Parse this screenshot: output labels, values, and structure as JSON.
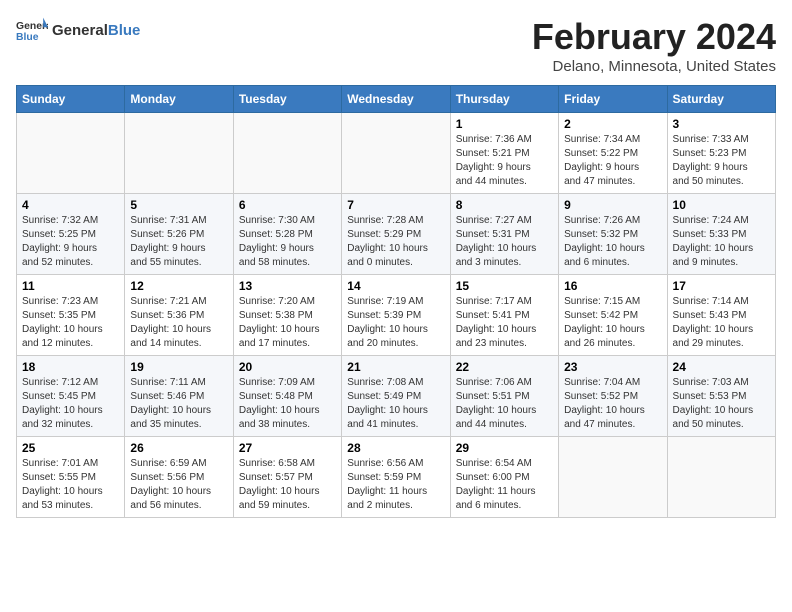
{
  "header": {
    "logo_general": "General",
    "logo_blue": "Blue",
    "month_year": "February 2024",
    "location": "Delano, Minnesota, United States"
  },
  "days_of_week": [
    "Sunday",
    "Monday",
    "Tuesday",
    "Wednesday",
    "Thursday",
    "Friday",
    "Saturday"
  ],
  "weeks": [
    [
      {
        "day": "",
        "info": ""
      },
      {
        "day": "",
        "info": ""
      },
      {
        "day": "",
        "info": ""
      },
      {
        "day": "",
        "info": ""
      },
      {
        "day": "1",
        "info": "Sunrise: 7:36 AM\nSunset: 5:21 PM\nDaylight: 9 hours\nand 44 minutes."
      },
      {
        "day": "2",
        "info": "Sunrise: 7:34 AM\nSunset: 5:22 PM\nDaylight: 9 hours\nand 47 minutes."
      },
      {
        "day": "3",
        "info": "Sunrise: 7:33 AM\nSunset: 5:23 PM\nDaylight: 9 hours\nand 50 minutes."
      }
    ],
    [
      {
        "day": "4",
        "info": "Sunrise: 7:32 AM\nSunset: 5:25 PM\nDaylight: 9 hours\nand 52 minutes."
      },
      {
        "day": "5",
        "info": "Sunrise: 7:31 AM\nSunset: 5:26 PM\nDaylight: 9 hours\nand 55 minutes."
      },
      {
        "day": "6",
        "info": "Sunrise: 7:30 AM\nSunset: 5:28 PM\nDaylight: 9 hours\nand 58 minutes."
      },
      {
        "day": "7",
        "info": "Sunrise: 7:28 AM\nSunset: 5:29 PM\nDaylight: 10 hours\nand 0 minutes."
      },
      {
        "day": "8",
        "info": "Sunrise: 7:27 AM\nSunset: 5:31 PM\nDaylight: 10 hours\nand 3 minutes."
      },
      {
        "day": "9",
        "info": "Sunrise: 7:26 AM\nSunset: 5:32 PM\nDaylight: 10 hours\nand 6 minutes."
      },
      {
        "day": "10",
        "info": "Sunrise: 7:24 AM\nSunset: 5:33 PM\nDaylight: 10 hours\nand 9 minutes."
      }
    ],
    [
      {
        "day": "11",
        "info": "Sunrise: 7:23 AM\nSunset: 5:35 PM\nDaylight: 10 hours\nand 12 minutes."
      },
      {
        "day": "12",
        "info": "Sunrise: 7:21 AM\nSunset: 5:36 PM\nDaylight: 10 hours\nand 14 minutes."
      },
      {
        "day": "13",
        "info": "Sunrise: 7:20 AM\nSunset: 5:38 PM\nDaylight: 10 hours\nand 17 minutes."
      },
      {
        "day": "14",
        "info": "Sunrise: 7:19 AM\nSunset: 5:39 PM\nDaylight: 10 hours\nand 20 minutes."
      },
      {
        "day": "15",
        "info": "Sunrise: 7:17 AM\nSunset: 5:41 PM\nDaylight: 10 hours\nand 23 minutes."
      },
      {
        "day": "16",
        "info": "Sunrise: 7:15 AM\nSunset: 5:42 PM\nDaylight: 10 hours\nand 26 minutes."
      },
      {
        "day": "17",
        "info": "Sunrise: 7:14 AM\nSunset: 5:43 PM\nDaylight: 10 hours\nand 29 minutes."
      }
    ],
    [
      {
        "day": "18",
        "info": "Sunrise: 7:12 AM\nSunset: 5:45 PM\nDaylight: 10 hours\nand 32 minutes."
      },
      {
        "day": "19",
        "info": "Sunrise: 7:11 AM\nSunset: 5:46 PM\nDaylight: 10 hours\nand 35 minutes."
      },
      {
        "day": "20",
        "info": "Sunrise: 7:09 AM\nSunset: 5:48 PM\nDaylight: 10 hours\nand 38 minutes."
      },
      {
        "day": "21",
        "info": "Sunrise: 7:08 AM\nSunset: 5:49 PM\nDaylight: 10 hours\nand 41 minutes."
      },
      {
        "day": "22",
        "info": "Sunrise: 7:06 AM\nSunset: 5:51 PM\nDaylight: 10 hours\nand 44 minutes."
      },
      {
        "day": "23",
        "info": "Sunrise: 7:04 AM\nSunset: 5:52 PM\nDaylight: 10 hours\nand 47 minutes."
      },
      {
        "day": "24",
        "info": "Sunrise: 7:03 AM\nSunset: 5:53 PM\nDaylight: 10 hours\nand 50 minutes."
      }
    ],
    [
      {
        "day": "25",
        "info": "Sunrise: 7:01 AM\nSunset: 5:55 PM\nDaylight: 10 hours\nand 53 minutes."
      },
      {
        "day": "26",
        "info": "Sunrise: 6:59 AM\nSunset: 5:56 PM\nDaylight: 10 hours\nand 56 minutes."
      },
      {
        "day": "27",
        "info": "Sunrise: 6:58 AM\nSunset: 5:57 PM\nDaylight: 10 hours\nand 59 minutes."
      },
      {
        "day": "28",
        "info": "Sunrise: 6:56 AM\nSunset: 5:59 PM\nDaylight: 11 hours\nand 2 minutes."
      },
      {
        "day": "29",
        "info": "Sunrise: 6:54 AM\nSunset: 6:00 PM\nDaylight: 11 hours\nand 6 minutes."
      },
      {
        "day": "",
        "info": ""
      },
      {
        "day": "",
        "info": ""
      }
    ]
  ]
}
